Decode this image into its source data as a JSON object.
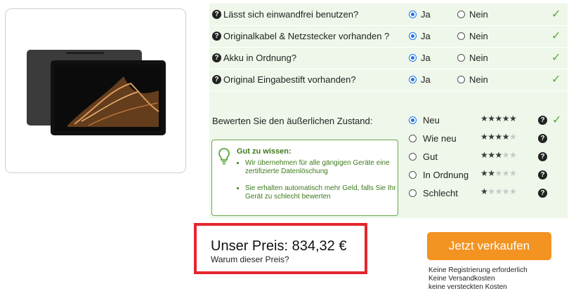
{
  "questions": [
    {
      "text": "Lässt sich einwandfrei benutzen?",
      "yes": "Ja",
      "no": "Nein",
      "selected": "yes"
    },
    {
      "text": "Originalkabel & Netzstecker vorhanden ?",
      "yes": "Ja",
      "no": "Nein",
      "selected": "yes"
    },
    {
      "text": "Akku in Ordnung?",
      "yes": "Ja",
      "no": "Nein",
      "selected": "yes"
    },
    {
      "text": "Original Eingabestift vorhanden?",
      "yes": "Ja",
      "no": "Nein",
      "selected": "yes"
    }
  ],
  "condition": {
    "label": "Bewerten Sie den äußerlichen Zustand:",
    "options": [
      {
        "label": "Neu",
        "stars": 5,
        "selected": true
      },
      {
        "label": "Wie neu",
        "stars": 4,
        "selected": false
      },
      {
        "label": "Gut",
        "stars": 3,
        "selected": false
      },
      {
        "label": "In Ordnung",
        "stars": 2,
        "selected": false
      },
      {
        "label": "Schlecht",
        "stars": 1,
        "selected": false
      }
    ]
  },
  "tip": {
    "title": "Gut zu wissen:",
    "items": [
      "Wir übernehmen für alle gängigen Geräte eine zertifizierte Datenlöschung",
      "Sie erhalten automatisch mehr Geld, falls Sie Ihr Gerät zu schlecht bewerten"
    ]
  },
  "price": {
    "label": "Unser Preis: 834,32 €",
    "why": "Warum dieser Preis?"
  },
  "sell_button": "Jetzt verkaufen",
  "benefits": [
    "Keine Registrierung erforderlich",
    "Keine Versandkosten",
    "keine versteckten Kosten"
  ],
  "colors": {
    "accent": "#f39322",
    "check": "#5aa83a",
    "panel": "#eef7ea",
    "highlight": "#e3262e"
  }
}
